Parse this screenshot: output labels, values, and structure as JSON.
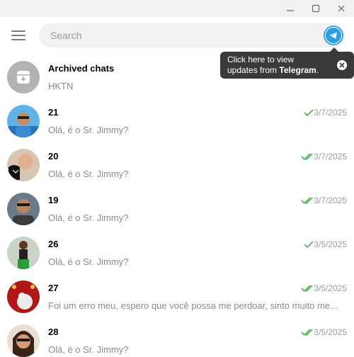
{
  "search": {
    "placeholder": "Search"
  },
  "tooltip": {
    "line1": "Click here to view",
    "line2_prefix": "updates from ",
    "line2_bold": "Telegram",
    "line2_suffix": "."
  },
  "archived": {
    "name": "Archived chats",
    "preview": "HKTN"
  },
  "chats": [
    {
      "name": "21",
      "preview": "Olá, é o Sr. Jimmy?",
      "date": "3/7/2025",
      "status": "sent"
    },
    {
      "name": "20",
      "preview": "Olá, é o Sr. Jimmy?",
      "date": "3/7/2025",
      "status": "read"
    },
    {
      "name": "19",
      "preview": "Olá, é o Sr. Jimmy?",
      "date": "3/7/2025",
      "status": "read"
    },
    {
      "name": "26",
      "preview": "Olá, é o Sr. Jimmy?",
      "date": "3/5/2025",
      "status": "sent"
    },
    {
      "name": "27",
      "preview": "Foi um erro meu, espero que você possa me perdoar, sinto muito me...",
      "date": "3/5/2025",
      "status": "read"
    },
    {
      "name": "28",
      "preview": "Olá, é o Sr. Jimmy?",
      "date": "3/5/2025",
      "status": "read"
    }
  ],
  "colors": {
    "check": "#4caf50",
    "accent": "#3aa0e0",
    "tooltip_bg": "#3a3a3a"
  }
}
